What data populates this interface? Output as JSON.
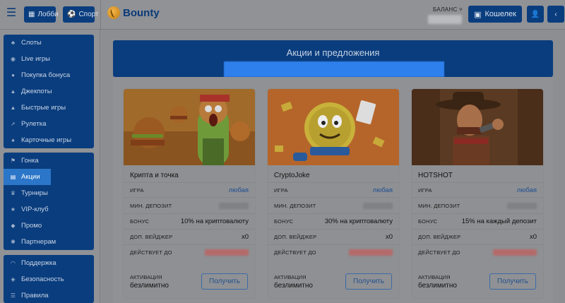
{
  "topbar": {
    "lobby_label": "Лобби",
    "sport_label": "Спорт",
    "logo_text": "Bounty",
    "balance_label": "БАЛАНС",
    "wallet_label": "Кошелек"
  },
  "sidebar": {
    "group1": [
      {
        "label": "Слоты",
        "icon": "cherry-icon"
      },
      {
        "label": "Live игры",
        "icon": "live-icon"
      },
      {
        "label": "Покупка бонуса",
        "icon": "coin-icon"
      },
      {
        "label": "Джекпоты",
        "icon": "fire-icon"
      },
      {
        "label": "Быстрые игры",
        "icon": "flame-icon"
      },
      {
        "label": "Рулетка",
        "icon": "rocket-icon"
      },
      {
        "label": "Карточные игры",
        "icon": "cards-icon"
      }
    ],
    "group2": [
      {
        "label": "Гонка",
        "icon": "race-icon"
      },
      {
        "label": "Акции",
        "icon": "gift-icon",
        "active": true
      },
      {
        "label": "Турниры",
        "icon": "trophy-icon"
      },
      {
        "label": "VIP-клуб",
        "icon": "star-icon"
      },
      {
        "label": "Промо",
        "icon": "promo-icon"
      },
      {
        "label": "Партнерам",
        "icon": "partner-icon"
      }
    ],
    "group3": [
      {
        "label": "Поддержка",
        "icon": "headset-icon"
      },
      {
        "label": "Безопасность",
        "icon": "shield-icon"
      },
      {
        "label": "Правила",
        "icon": "rules-icon"
      }
    ]
  },
  "main": {
    "title": "Акции и предложения",
    "labels": {
      "game": "ИГРА",
      "min_deposit": "МИН. ДЕПОЗИТ",
      "bonus": "БОНУС",
      "wager": "ДОП. ВЕЙДЖЕР",
      "valid_until": "ДЕЙСТВУЕТ ДО",
      "activation": "АКТИВАЦИЯ"
    },
    "cards": [
      {
        "name": "Крипта и точка",
        "game": "любая",
        "bonus": "10% на криптовалюту",
        "wager": "x0",
        "activation": "безлимитно",
        "button": "Получить"
      },
      {
        "name": "CryptoJoke",
        "game": "любая",
        "bonus": "30% на криптовалюту",
        "wager": "x0",
        "activation": "безлимитно",
        "button": "Получить"
      },
      {
        "name": "HOTSHOT",
        "game": "любая",
        "bonus": "15% на каждый депозит",
        "wager": "x0",
        "activation": "безлимитно",
        "button": "Получить"
      }
    ]
  },
  "colors": {
    "primary": "#0a3d7e",
    "active": "#2b76c8",
    "banner": "#2e80ec"
  }
}
